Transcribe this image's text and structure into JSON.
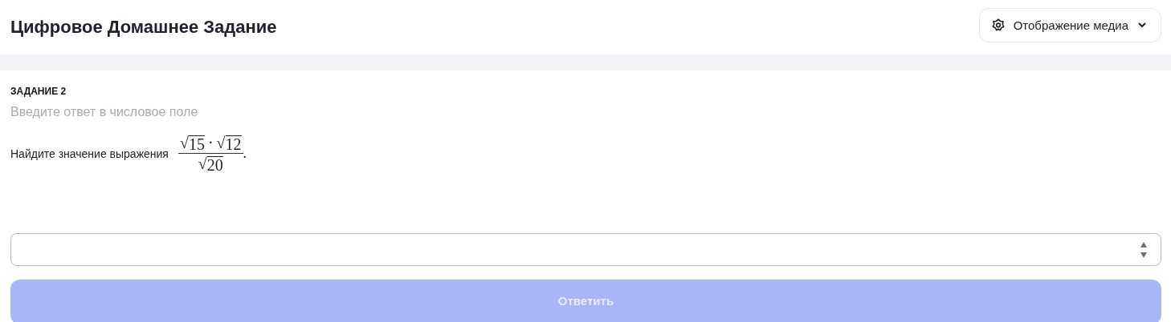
{
  "header": {
    "title": "Цифровое Домашнее Задание",
    "media_button": {
      "label": "Отображение медиа"
    }
  },
  "task": {
    "heading": "ЗАДАНИЕ 2",
    "hint": "Введите ответ в числовое поле",
    "prompt": "Найдите значение выражения",
    "formula": {
      "numerator": [
        {
          "sign": "√",
          "radicand": "15"
        },
        {
          "sign": "√",
          "radicand": "12"
        }
      ],
      "operator": "·",
      "denominator": [
        {
          "sign": "√",
          "radicand": "20"
        }
      ],
      "suffix": "."
    }
  },
  "answer_field": {
    "spinner": true
  },
  "submit_button": {
    "label": "Ответить",
    "disabled": true
  }
}
